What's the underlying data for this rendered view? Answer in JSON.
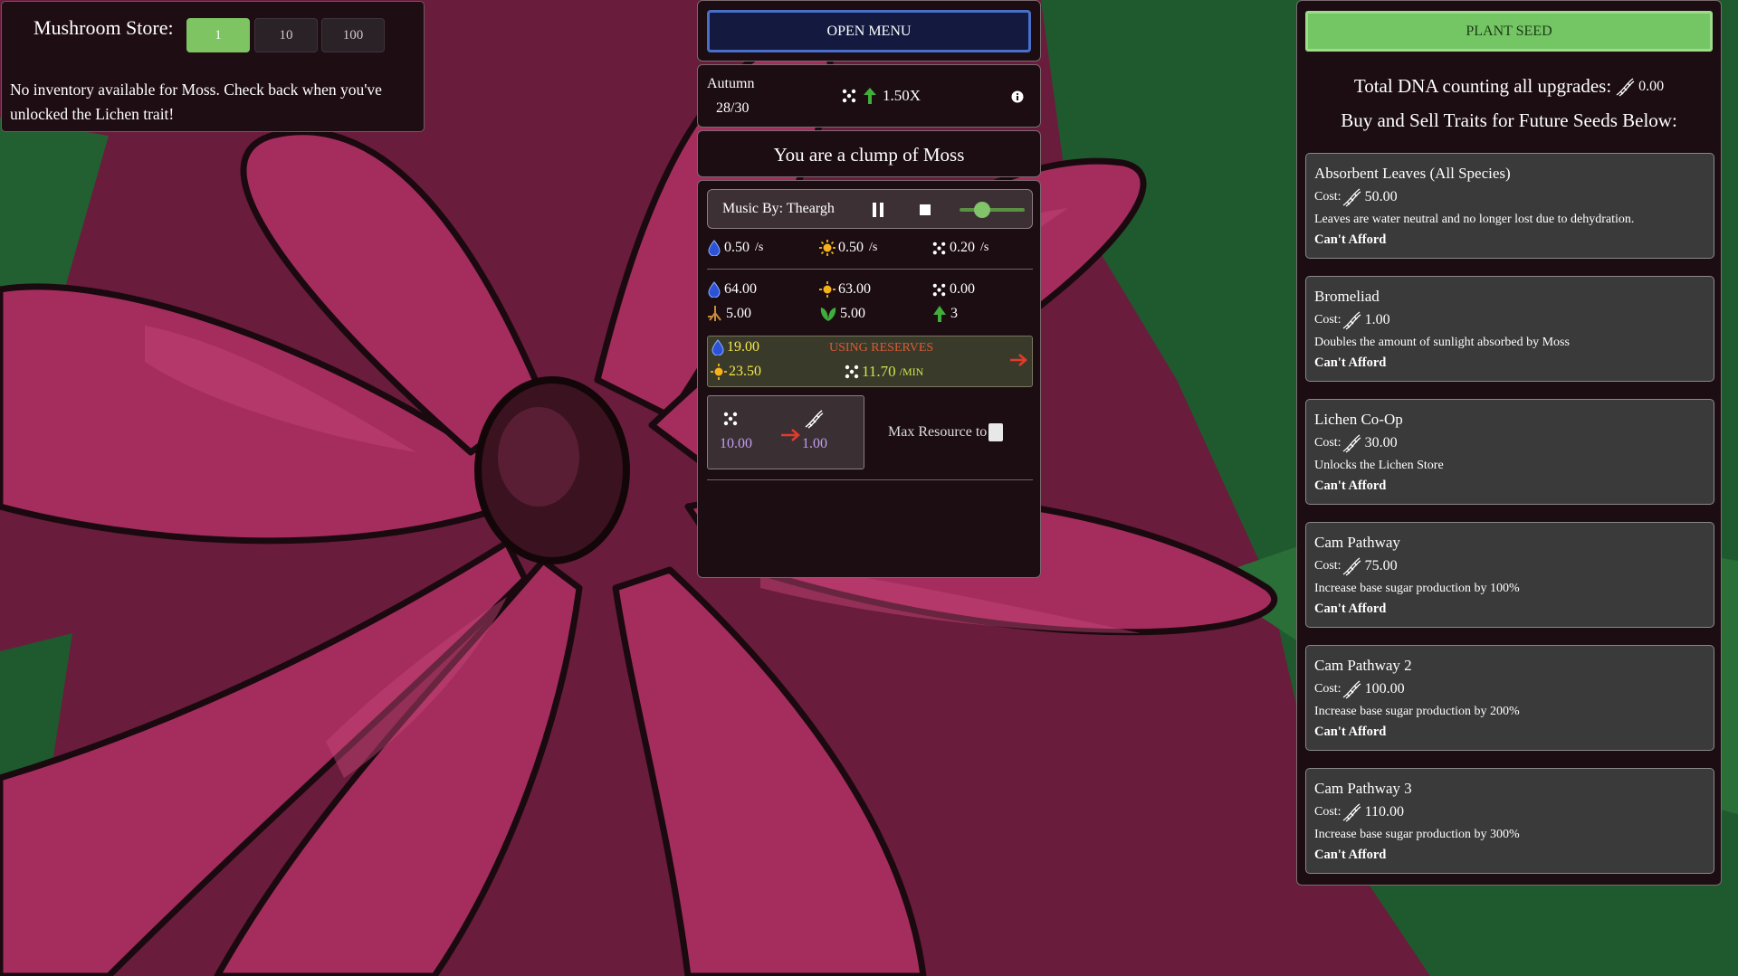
{
  "store": {
    "title": "Mushroom Store:",
    "qty_options": [
      "1",
      "10",
      "100"
    ],
    "qty_selected": "1",
    "message": "No inventory available for Moss. Check back when you've unlocked the Lichen trait!"
  },
  "center": {
    "open_menu": "OPEN MENU",
    "season": {
      "name": "Autumn",
      "day": "28/30",
      "multiplier": "1.50X"
    },
    "identity": "You are a clump of Moss",
    "music": {
      "label": "Music By: Theargh",
      "volume_level": 0.35
    },
    "rates": {
      "water": "0.50",
      "sun": "0.50",
      "dna": "0.20",
      "unit": "/s"
    },
    "totals": {
      "water": "64.00",
      "sun": "63.00",
      "dna": "0.00",
      "roots": "5.00",
      "leaves": "5.00",
      "trees": "3"
    },
    "reserves": {
      "water": "19.00",
      "sun": "23.50",
      "label": "USING RESERVES",
      "dna_rate": "11.70",
      "rate_unit": "/MIN"
    },
    "converter": {
      "input": "10.00",
      "output": "1.00",
      "max_label": "Max Resource to"
    }
  },
  "right": {
    "plant_seed": "PLANT SEED",
    "total_dna_label": "Total DNA counting all upgrades:",
    "total_dna_value": "0.00",
    "buy_sell": "Buy and Sell Traits for Future Seeds Below:",
    "cost_label": "Cost:",
    "traits": [
      {
        "name": "Absorbent Leaves (All Species)",
        "cost": "50.00",
        "desc": "Leaves are water neutral and no longer lost due to dehydration.",
        "status": "Can't Afford"
      },
      {
        "name": "Bromeliad",
        "cost": "1.00",
        "desc": "Doubles the amount of sunlight absorbed by Moss",
        "status": "Can't Afford"
      },
      {
        "name": "Lichen Co-Op",
        "cost": "30.00",
        "desc": "Unlocks the Lichen Store",
        "status": "Can't Afford"
      },
      {
        "name": "Cam Pathway",
        "cost": "75.00",
        "desc": "Increase base sugar production by 100%",
        "status": "Can't Afford"
      },
      {
        "name": "Cam Pathway 2",
        "cost": "100.00",
        "desc": "Increase base sugar production by 200%",
        "status": "Can't Afford"
      },
      {
        "name": "Cam Pathway 3",
        "cost": "110.00",
        "desc": "Increase base sugar production by 300%",
        "status": "Can't Afford"
      }
    ]
  },
  "icons": [
    "water-drop-icon",
    "sun-icon",
    "dna-dots-icon",
    "dna-helix-icon",
    "roots-icon",
    "leaves-icon",
    "tree-icon",
    "up-arrow-icon",
    "info-icon",
    "red-arrow-icon",
    "pause-icon",
    "stop-icon"
  ],
  "colors": {
    "accent_green": "#74c664",
    "menu_blue": "#4a6fc9",
    "reserve_yellow": "#f4e84a",
    "reserve_label": "#d95a34",
    "converter_purple": "#c49df0"
  }
}
